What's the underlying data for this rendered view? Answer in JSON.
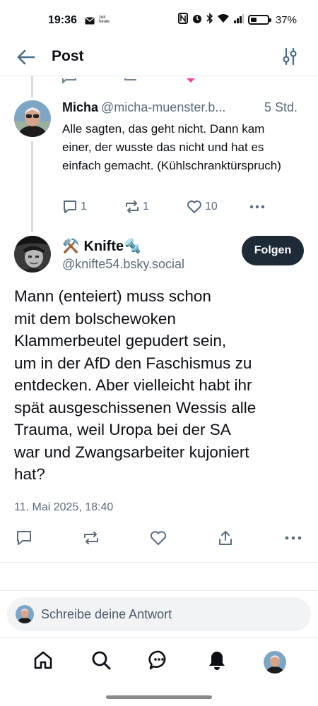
{
  "status_bar": {
    "time": "19:36",
    "notif_app_label": "zeit heute",
    "battery": "37%"
  },
  "header": {
    "title": "Post"
  },
  "reply": {
    "author_name": "Micha",
    "author_handle": "@micha-muenster.b...",
    "age": "5 Std.",
    "text": "Alle sagten, das geht nicht. Dann kam einer, der wusste das nicht und hat es einfach gemacht. (Kühlschranktürspruch)",
    "reply_count": "1",
    "repost_count": "1",
    "like_count": "10"
  },
  "post": {
    "author_name": "⚒️ Knifte🔩",
    "author_handle": "@knifte54.bsky.social",
    "follow_label": "Folgen",
    "body": "Mann (enteiert) muss schon\nmit dem bolschewoken\nKlammerbeutel gepudert sein,\num in der AfD den Faschismus zu\nentdecken. Aber vielleicht habt ihr\nspät ausgeschissenen Wessis alle\nTrauma, weil Uropa bei der SA\nwar und Zwangsarbeiter kujoniert\nhat?",
    "date": "11. Mai 2025, 18:40"
  },
  "compose": {
    "placeholder": "Schreibe deine Antwort"
  },
  "colors": {
    "text": "#0b0f14",
    "muted": "#5b6b7c",
    "follow_bg": "#1e2a35",
    "divider": "#e6eaef"
  },
  "icons": [
    "back-arrow-icon",
    "filter-icon",
    "reply-icon",
    "repost-icon",
    "like-icon",
    "share-icon",
    "more-icon",
    "home-icon",
    "search-icon",
    "chat-icon",
    "bell-icon"
  ]
}
